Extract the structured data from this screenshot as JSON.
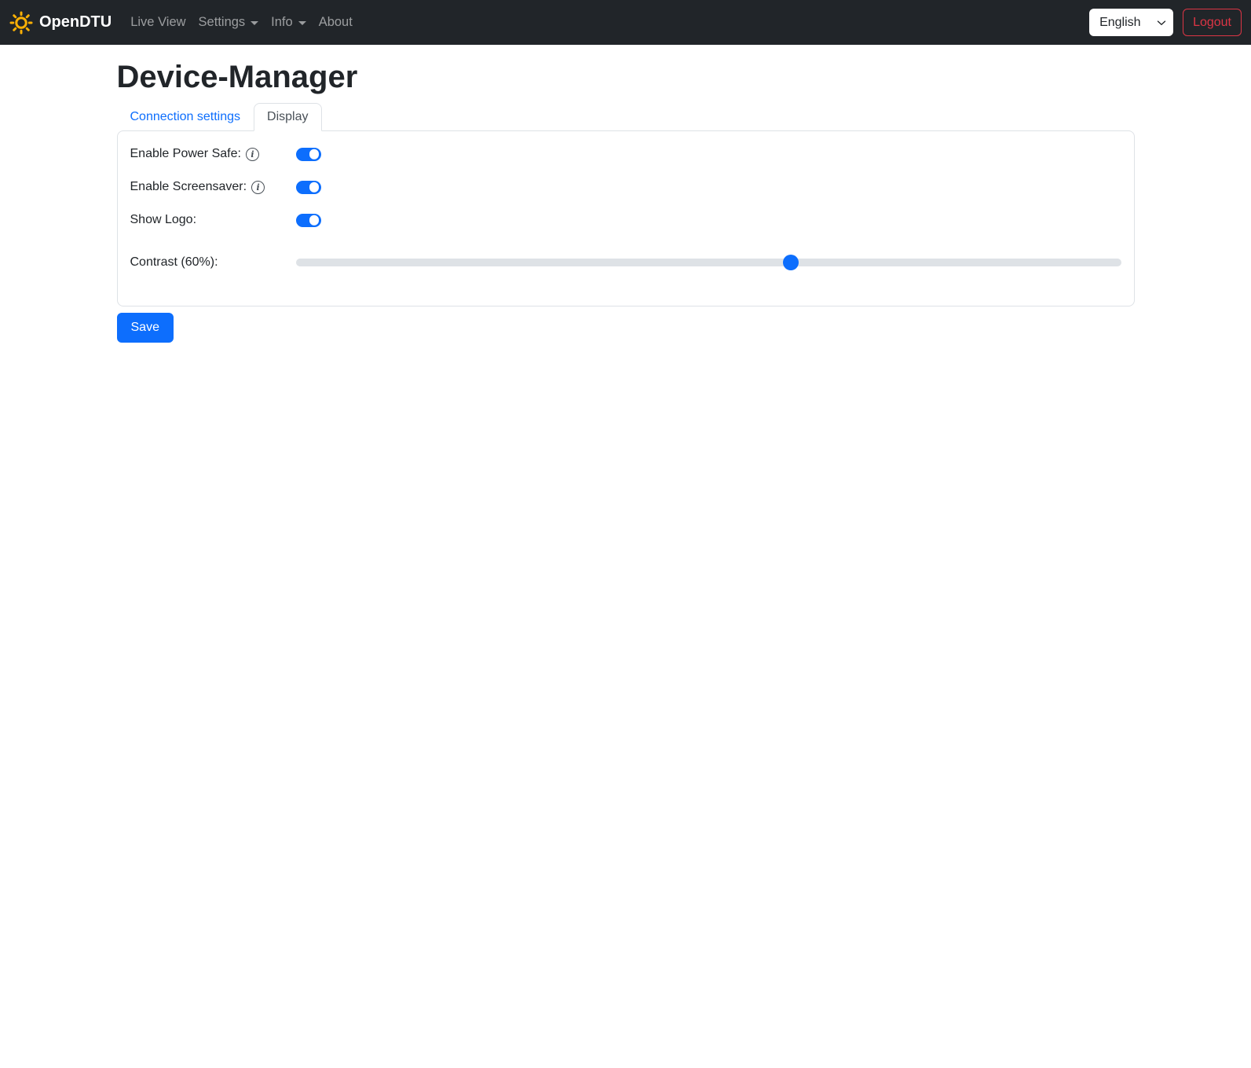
{
  "navbar": {
    "brand": "OpenDTU",
    "items": [
      {
        "label": "Live View",
        "caret": false
      },
      {
        "label": "Settings",
        "caret": true
      },
      {
        "label": "Info",
        "caret": true
      },
      {
        "label": "About",
        "caret": false
      }
    ],
    "language": {
      "selected": "English"
    },
    "logout_label": "Logout"
  },
  "page": {
    "title": "Device-Manager"
  },
  "tabs": [
    {
      "label": "Connection settings",
      "active": false
    },
    {
      "label": "Display",
      "active": true
    }
  ],
  "form": {
    "rows": [
      {
        "label": "Enable Power Safe:",
        "type": "switch",
        "has_info": true,
        "value": true
      },
      {
        "label": "Enable Screensaver:",
        "type": "switch",
        "has_info": true,
        "value": true
      },
      {
        "label": "Show Logo:",
        "type": "switch",
        "has_info": false,
        "value": true
      },
      {
        "label": "Contrast (60%):",
        "type": "range",
        "value_percent": 60
      }
    ],
    "save_label": "Save"
  },
  "icons": {
    "info_glyph": "i"
  },
  "colors": {
    "navbar_bg": "#212529",
    "accent": "#0d6efd",
    "danger": "#dc3545",
    "border": "#dee2e6",
    "slider_track": "#dee2e6",
    "sun": "#fab005"
  }
}
